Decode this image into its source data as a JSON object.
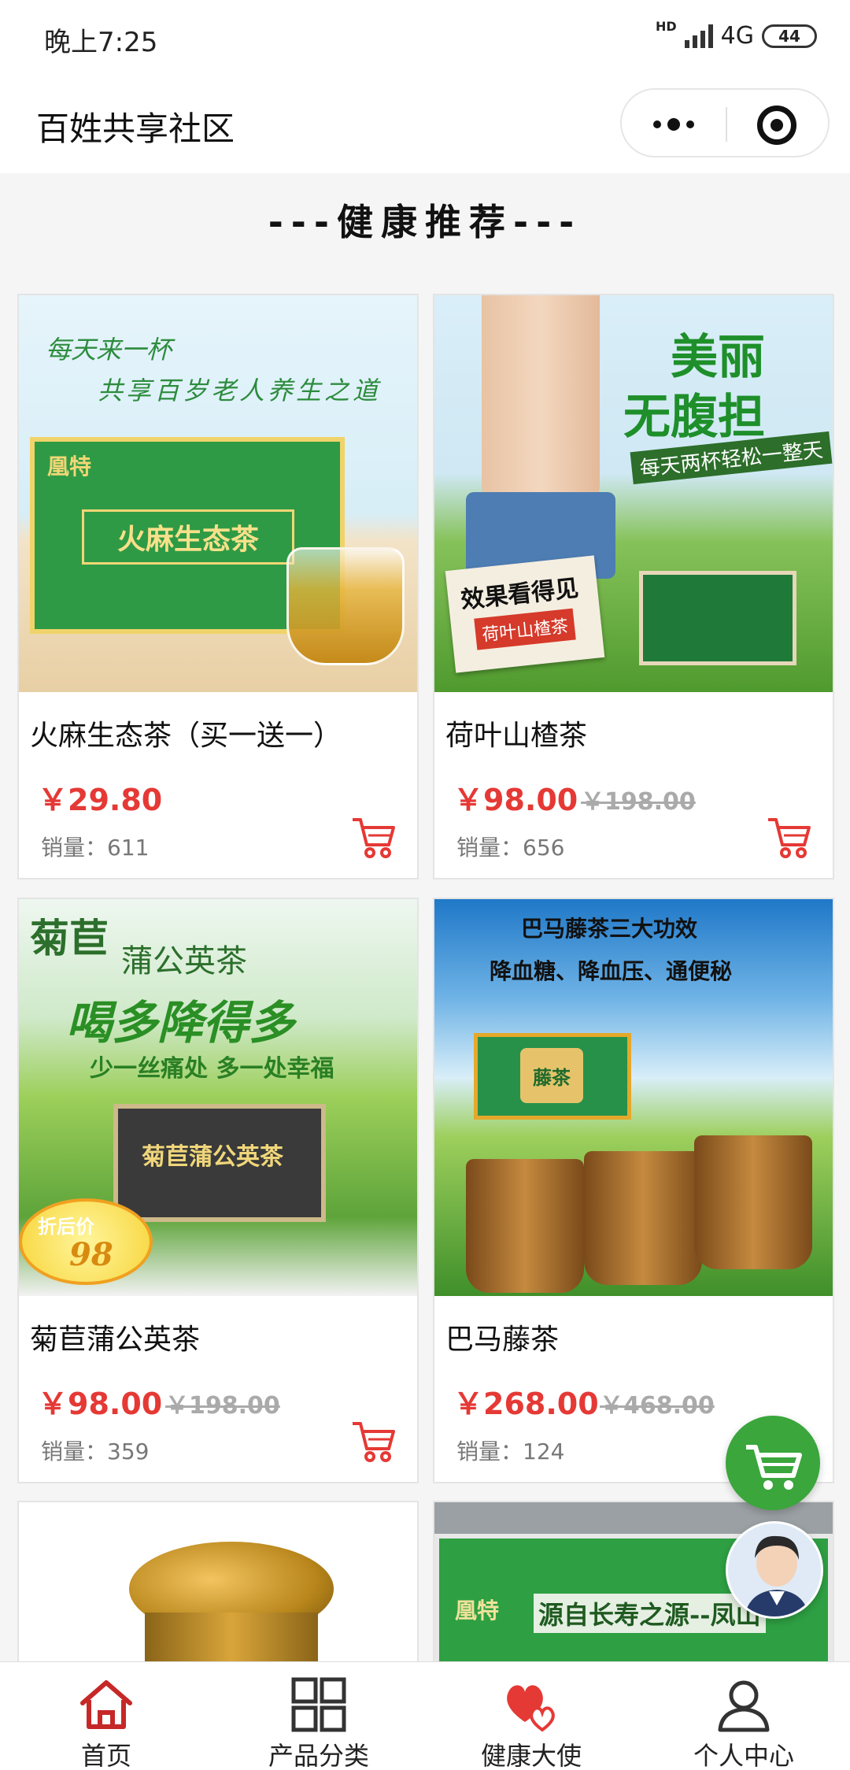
{
  "status_bar": {
    "time": "晚上7:25",
    "hd": "HD",
    "network": "4G",
    "battery": "44"
  },
  "nav": {
    "title": "百姓共享社区",
    "more_icon": "more-dots-icon",
    "close_icon": "target-close-icon"
  },
  "section": {
    "title": "---健康推荐---"
  },
  "products": [
    {
      "name": "火麻生态茶（买一送一）",
      "price": "￥29.80",
      "old_price": "",
      "sales": "销量：611",
      "image_lines": [
        "每天来一杯",
        "共享百岁老人养生之道",
        "凰特",
        "火麻生态茶"
      ]
    },
    {
      "name": "荷叶山楂茶",
      "price": "￥98.00",
      "old_price": "￥198.00",
      "sales": "销量：656",
      "image_lines": [
        "美丽",
        "无腹担",
        "每天两杯轻松一整天",
        "效果看得见",
        "荷叶山楂茶"
      ]
    },
    {
      "name": "菊苣蒲公英茶",
      "price": "￥98.00",
      "old_price": "￥198.00",
      "sales": "销量：359",
      "image_lines": [
        "菊苣",
        "蒲公英茶",
        "喝多降得多",
        "少一丝痛处 多一处幸福",
        "菊苣蒲公英茶",
        "折后价",
        "98"
      ]
    },
    {
      "name": "巴马藤茶",
      "price": "￥268.00",
      "old_price": "￥468.00",
      "sales": "销量：124",
      "image_lines": [
        "巴马藤茶三大功效",
        "降血糖、降血压、通便秘",
        "藤茶"
      ]
    },
    {
      "name": "",
      "price": "",
      "old_price": "",
      "sales": "",
      "image_lines": []
    },
    {
      "name": "",
      "price": "",
      "old_price": "",
      "sales": "",
      "image_lines": [
        "凰特",
        "源自长寿之源--凤山"
      ]
    }
  ],
  "tabs": [
    {
      "label": "首页",
      "icon": "home-icon",
      "color": "#d33"
    },
    {
      "label": "产品分类",
      "icon": "grid-icon",
      "color": "#333"
    },
    {
      "label": "健康大使",
      "icon": "hearts-icon",
      "color": "#e53935"
    },
    {
      "label": "个人中心",
      "icon": "person-icon",
      "color": "#333"
    }
  ],
  "colors": {
    "price_red": "#e53935",
    "cart_green": "#3aa63c",
    "cart_icon_red": "#e53935"
  }
}
